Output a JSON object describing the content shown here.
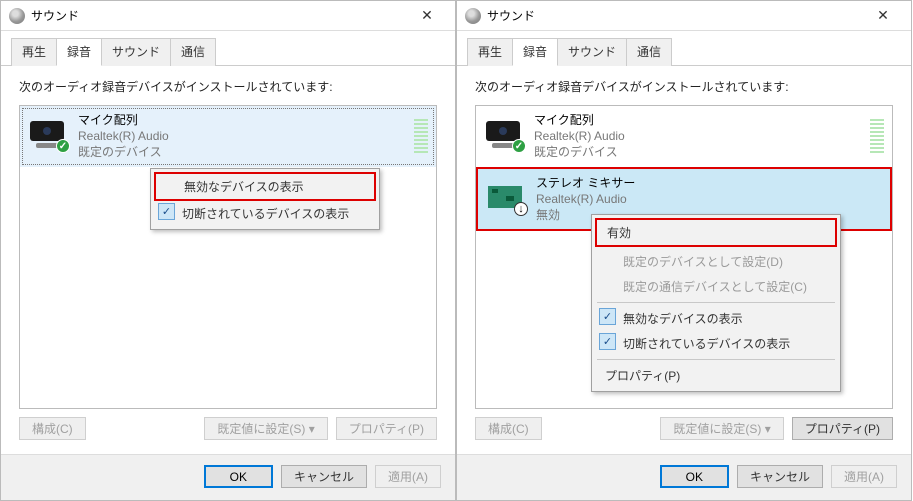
{
  "left": {
    "title": "サウンド",
    "tabs": {
      "play": "再生",
      "record": "録音",
      "sound": "サウンド",
      "comm": "通信"
    },
    "instruction": "次のオーディオ録音デバイスがインストールされています:",
    "device1": {
      "name": "マイク配列",
      "driver": "Realtek(R) Audio",
      "status": "既定のデバイス"
    },
    "ctx": {
      "showDisabled": "無効なデバイスの表示",
      "showDisconnected": "切断されているデバイスの表示"
    },
    "buttons": {
      "configure": "構成(C)",
      "setDefault": "既定値に設定(S)",
      "properties": "プロパティ(P)"
    },
    "footer": {
      "ok": "OK",
      "cancel": "キャンセル",
      "apply": "適用(A)"
    }
  },
  "right": {
    "title": "サウンド",
    "tabs": {
      "play": "再生",
      "record": "録音",
      "sound": "サウンド",
      "comm": "通信"
    },
    "instruction": "次のオーディオ録音デバイスがインストールされています:",
    "device1": {
      "name": "マイク配列",
      "driver": "Realtek(R) Audio",
      "status": "既定のデバイス"
    },
    "device2": {
      "name": "ステレオ ミキサー",
      "driver": "Realtek(R) Audio",
      "status": "無効"
    },
    "ctx": {
      "enable": "有効",
      "setPlayback": "既定のデバイスとして設定(D)",
      "setComm": "既定の通信デバイスとして設定(C)",
      "showDisabled": "無効なデバイスの表示",
      "showDisconnected": "切断されているデバイスの表示",
      "properties": "プロパティ(P)"
    },
    "buttons": {
      "configure": "構成(C)",
      "setDefault": "既定値に設定(S)",
      "properties": "プロパティ(P)"
    },
    "footer": {
      "ok": "OK",
      "cancel": "キャンセル",
      "apply": "適用(A)"
    }
  }
}
